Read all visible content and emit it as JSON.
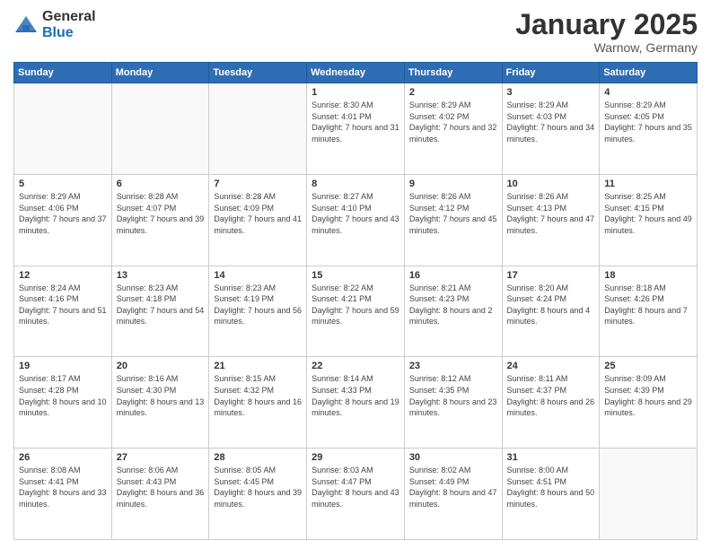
{
  "logo": {
    "general": "General",
    "blue": "Blue"
  },
  "header": {
    "month": "January 2025",
    "location": "Warnow, Germany"
  },
  "weekdays": [
    "Sunday",
    "Monday",
    "Tuesday",
    "Wednesday",
    "Thursday",
    "Friday",
    "Saturday"
  ],
  "weeks": [
    [
      {
        "day": "",
        "sunrise": "",
        "sunset": "",
        "daylight": ""
      },
      {
        "day": "",
        "sunrise": "",
        "sunset": "",
        "daylight": ""
      },
      {
        "day": "",
        "sunrise": "",
        "sunset": "",
        "daylight": ""
      },
      {
        "day": "1",
        "sunrise": "Sunrise: 8:30 AM",
        "sunset": "Sunset: 4:01 PM",
        "daylight": "Daylight: 7 hours and 31 minutes."
      },
      {
        "day": "2",
        "sunrise": "Sunrise: 8:29 AM",
        "sunset": "Sunset: 4:02 PM",
        "daylight": "Daylight: 7 hours and 32 minutes."
      },
      {
        "day": "3",
        "sunrise": "Sunrise: 8:29 AM",
        "sunset": "Sunset: 4:03 PM",
        "daylight": "Daylight: 7 hours and 34 minutes."
      },
      {
        "day": "4",
        "sunrise": "Sunrise: 8:29 AM",
        "sunset": "Sunset: 4:05 PM",
        "daylight": "Daylight: 7 hours and 35 minutes."
      }
    ],
    [
      {
        "day": "5",
        "sunrise": "Sunrise: 8:29 AM",
        "sunset": "Sunset: 4:06 PM",
        "daylight": "Daylight: 7 hours and 37 minutes."
      },
      {
        "day": "6",
        "sunrise": "Sunrise: 8:28 AM",
        "sunset": "Sunset: 4:07 PM",
        "daylight": "Daylight: 7 hours and 39 minutes."
      },
      {
        "day": "7",
        "sunrise": "Sunrise: 8:28 AM",
        "sunset": "Sunset: 4:09 PM",
        "daylight": "Daylight: 7 hours and 41 minutes."
      },
      {
        "day": "8",
        "sunrise": "Sunrise: 8:27 AM",
        "sunset": "Sunset: 4:10 PM",
        "daylight": "Daylight: 7 hours and 43 minutes."
      },
      {
        "day": "9",
        "sunrise": "Sunrise: 8:26 AM",
        "sunset": "Sunset: 4:12 PM",
        "daylight": "Daylight: 7 hours and 45 minutes."
      },
      {
        "day": "10",
        "sunrise": "Sunrise: 8:26 AM",
        "sunset": "Sunset: 4:13 PM",
        "daylight": "Daylight: 7 hours and 47 minutes."
      },
      {
        "day": "11",
        "sunrise": "Sunrise: 8:25 AM",
        "sunset": "Sunset: 4:15 PM",
        "daylight": "Daylight: 7 hours and 49 minutes."
      }
    ],
    [
      {
        "day": "12",
        "sunrise": "Sunrise: 8:24 AM",
        "sunset": "Sunset: 4:16 PM",
        "daylight": "Daylight: 7 hours and 51 minutes."
      },
      {
        "day": "13",
        "sunrise": "Sunrise: 8:23 AM",
        "sunset": "Sunset: 4:18 PM",
        "daylight": "Daylight: 7 hours and 54 minutes."
      },
      {
        "day": "14",
        "sunrise": "Sunrise: 8:23 AM",
        "sunset": "Sunset: 4:19 PM",
        "daylight": "Daylight: 7 hours and 56 minutes."
      },
      {
        "day": "15",
        "sunrise": "Sunrise: 8:22 AM",
        "sunset": "Sunset: 4:21 PM",
        "daylight": "Daylight: 7 hours and 59 minutes."
      },
      {
        "day": "16",
        "sunrise": "Sunrise: 8:21 AM",
        "sunset": "Sunset: 4:23 PM",
        "daylight": "Daylight: 8 hours and 2 minutes."
      },
      {
        "day": "17",
        "sunrise": "Sunrise: 8:20 AM",
        "sunset": "Sunset: 4:24 PM",
        "daylight": "Daylight: 8 hours and 4 minutes."
      },
      {
        "day": "18",
        "sunrise": "Sunrise: 8:18 AM",
        "sunset": "Sunset: 4:26 PM",
        "daylight": "Daylight: 8 hours and 7 minutes."
      }
    ],
    [
      {
        "day": "19",
        "sunrise": "Sunrise: 8:17 AM",
        "sunset": "Sunset: 4:28 PM",
        "daylight": "Daylight: 8 hours and 10 minutes."
      },
      {
        "day": "20",
        "sunrise": "Sunrise: 8:16 AM",
        "sunset": "Sunset: 4:30 PM",
        "daylight": "Daylight: 8 hours and 13 minutes."
      },
      {
        "day": "21",
        "sunrise": "Sunrise: 8:15 AM",
        "sunset": "Sunset: 4:32 PM",
        "daylight": "Daylight: 8 hours and 16 minutes."
      },
      {
        "day": "22",
        "sunrise": "Sunrise: 8:14 AM",
        "sunset": "Sunset: 4:33 PM",
        "daylight": "Daylight: 8 hours and 19 minutes."
      },
      {
        "day": "23",
        "sunrise": "Sunrise: 8:12 AM",
        "sunset": "Sunset: 4:35 PM",
        "daylight": "Daylight: 8 hours and 23 minutes."
      },
      {
        "day": "24",
        "sunrise": "Sunrise: 8:11 AM",
        "sunset": "Sunset: 4:37 PM",
        "daylight": "Daylight: 8 hours and 26 minutes."
      },
      {
        "day": "25",
        "sunrise": "Sunrise: 8:09 AM",
        "sunset": "Sunset: 4:39 PM",
        "daylight": "Daylight: 8 hours and 29 minutes."
      }
    ],
    [
      {
        "day": "26",
        "sunrise": "Sunrise: 8:08 AM",
        "sunset": "Sunset: 4:41 PM",
        "daylight": "Daylight: 8 hours and 33 minutes."
      },
      {
        "day": "27",
        "sunrise": "Sunrise: 8:06 AM",
        "sunset": "Sunset: 4:43 PM",
        "daylight": "Daylight: 8 hours and 36 minutes."
      },
      {
        "day": "28",
        "sunrise": "Sunrise: 8:05 AM",
        "sunset": "Sunset: 4:45 PM",
        "daylight": "Daylight: 8 hours and 39 minutes."
      },
      {
        "day": "29",
        "sunrise": "Sunrise: 8:03 AM",
        "sunset": "Sunset: 4:47 PM",
        "daylight": "Daylight: 8 hours and 43 minutes."
      },
      {
        "day": "30",
        "sunrise": "Sunrise: 8:02 AM",
        "sunset": "Sunset: 4:49 PM",
        "daylight": "Daylight: 8 hours and 47 minutes."
      },
      {
        "day": "31",
        "sunrise": "Sunrise: 8:00 AM",
        "sunset": "Sunset: 4:51 PM",
        "daylight": "Daylight: 8 hours and 50 minutes."
      },
      {
        "day": "",
        "sunrise": "",
        "sunset": "",
        "daylight": ""
      }
    ]
  ]
}
